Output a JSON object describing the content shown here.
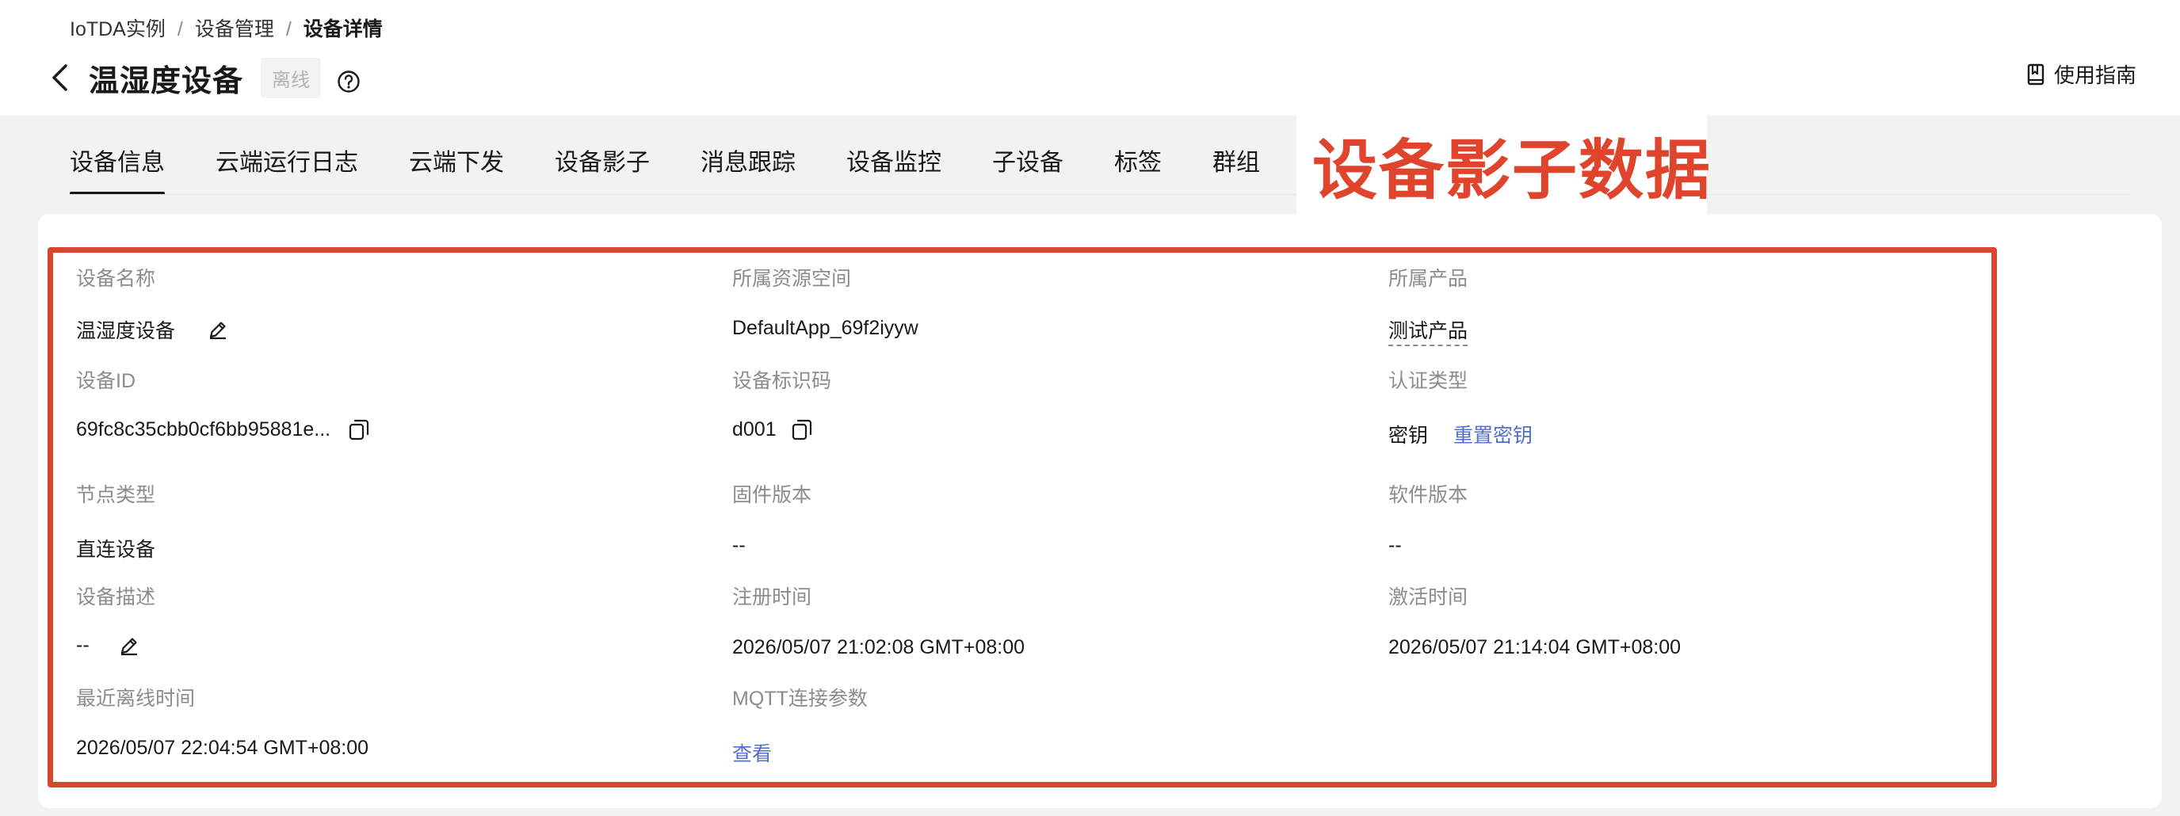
{
  "breadcrumb": {
    "items": [
      "IoTDA实例",
      "设备管理",
      "设备详情"
    ],
    "separator": "/"
  },
  "header": {
    "title": "温湿度设备",
    "status": "离线",
    "guide_label": "使用指南"
  },
  "tabs": [
    {
      "label": "设备信息",
      "active": true
    },
    {
      "label": "云端运行日志",
      "active": false
    },
    {
      "label": "云端下发",
      "active": false
    },
    {
      "label": "设备影子",
      "active": false
    },
    {
      "label": "消息跟踪",
      "active": false
    },
    {
      "label": "设备监控",
      "active": false
    },
    {
      "label": "子设备",
      "active": false
    },
    {
      "label": "标签",
      "active": false
    },
    {
      "label": "群组",
      "active": false
    }
  ],
  "overlay_label": "设备影子数据",
  "info": {
    "device_name": {
      "label": "设备名称",
      "value": "温湿度设备"
    },
    "resource_space": {
      "label": "所属资源空间",
      "value": "DefaultApp_69f2iyyw"
    },
    "product": {
      "label": "所属产品",
      "value": "测试产品"
    },
    "device_id": {
      "label": "设备ID",
      "value": "69fc8c35cbb0cf6bb95881e..."
    },
    "node_id": {
      "label": "设备标识码",
      "value": "d001"
    },
    "auth_type": {
      "label": "认证类型",
      "value": "密钥",
      "action": "重置密钥"
    },
    "node_type": {
      "label": "节点类型",
      "value": "直连设备"
    },
    "fw_version": {
      "label": "固件版本",
      "value": "--"
    },
    "sw_version": {
      "label": "软件版本",
      "value": "--"
    },
    "description": {
      "label": "设备描述",
      "value": "--"
    },
    "register_time": {
      "label": "注册时间",
      "value": "2026/05/07 21:02:08 GMT+08:00"
    },
    "activate_time": {
      "label": "激活时间",
      "value": "2026/05/07 21:14:04 GMT+08:00"
    },
    "offline_time": {
      "label": "最近离线时间",
      "value": "2026/05/07 22:04:54 GMT+08:00"
    },
    "mqtt": {
      "label": "MQTT连接参数",
      "value": "查看"
    }
  },
  "colors": {
    "accent_red": "#e0442c",
    "link_blue": "#526ecc",
    "label_gray": "#8c8c8c"
  }
}
